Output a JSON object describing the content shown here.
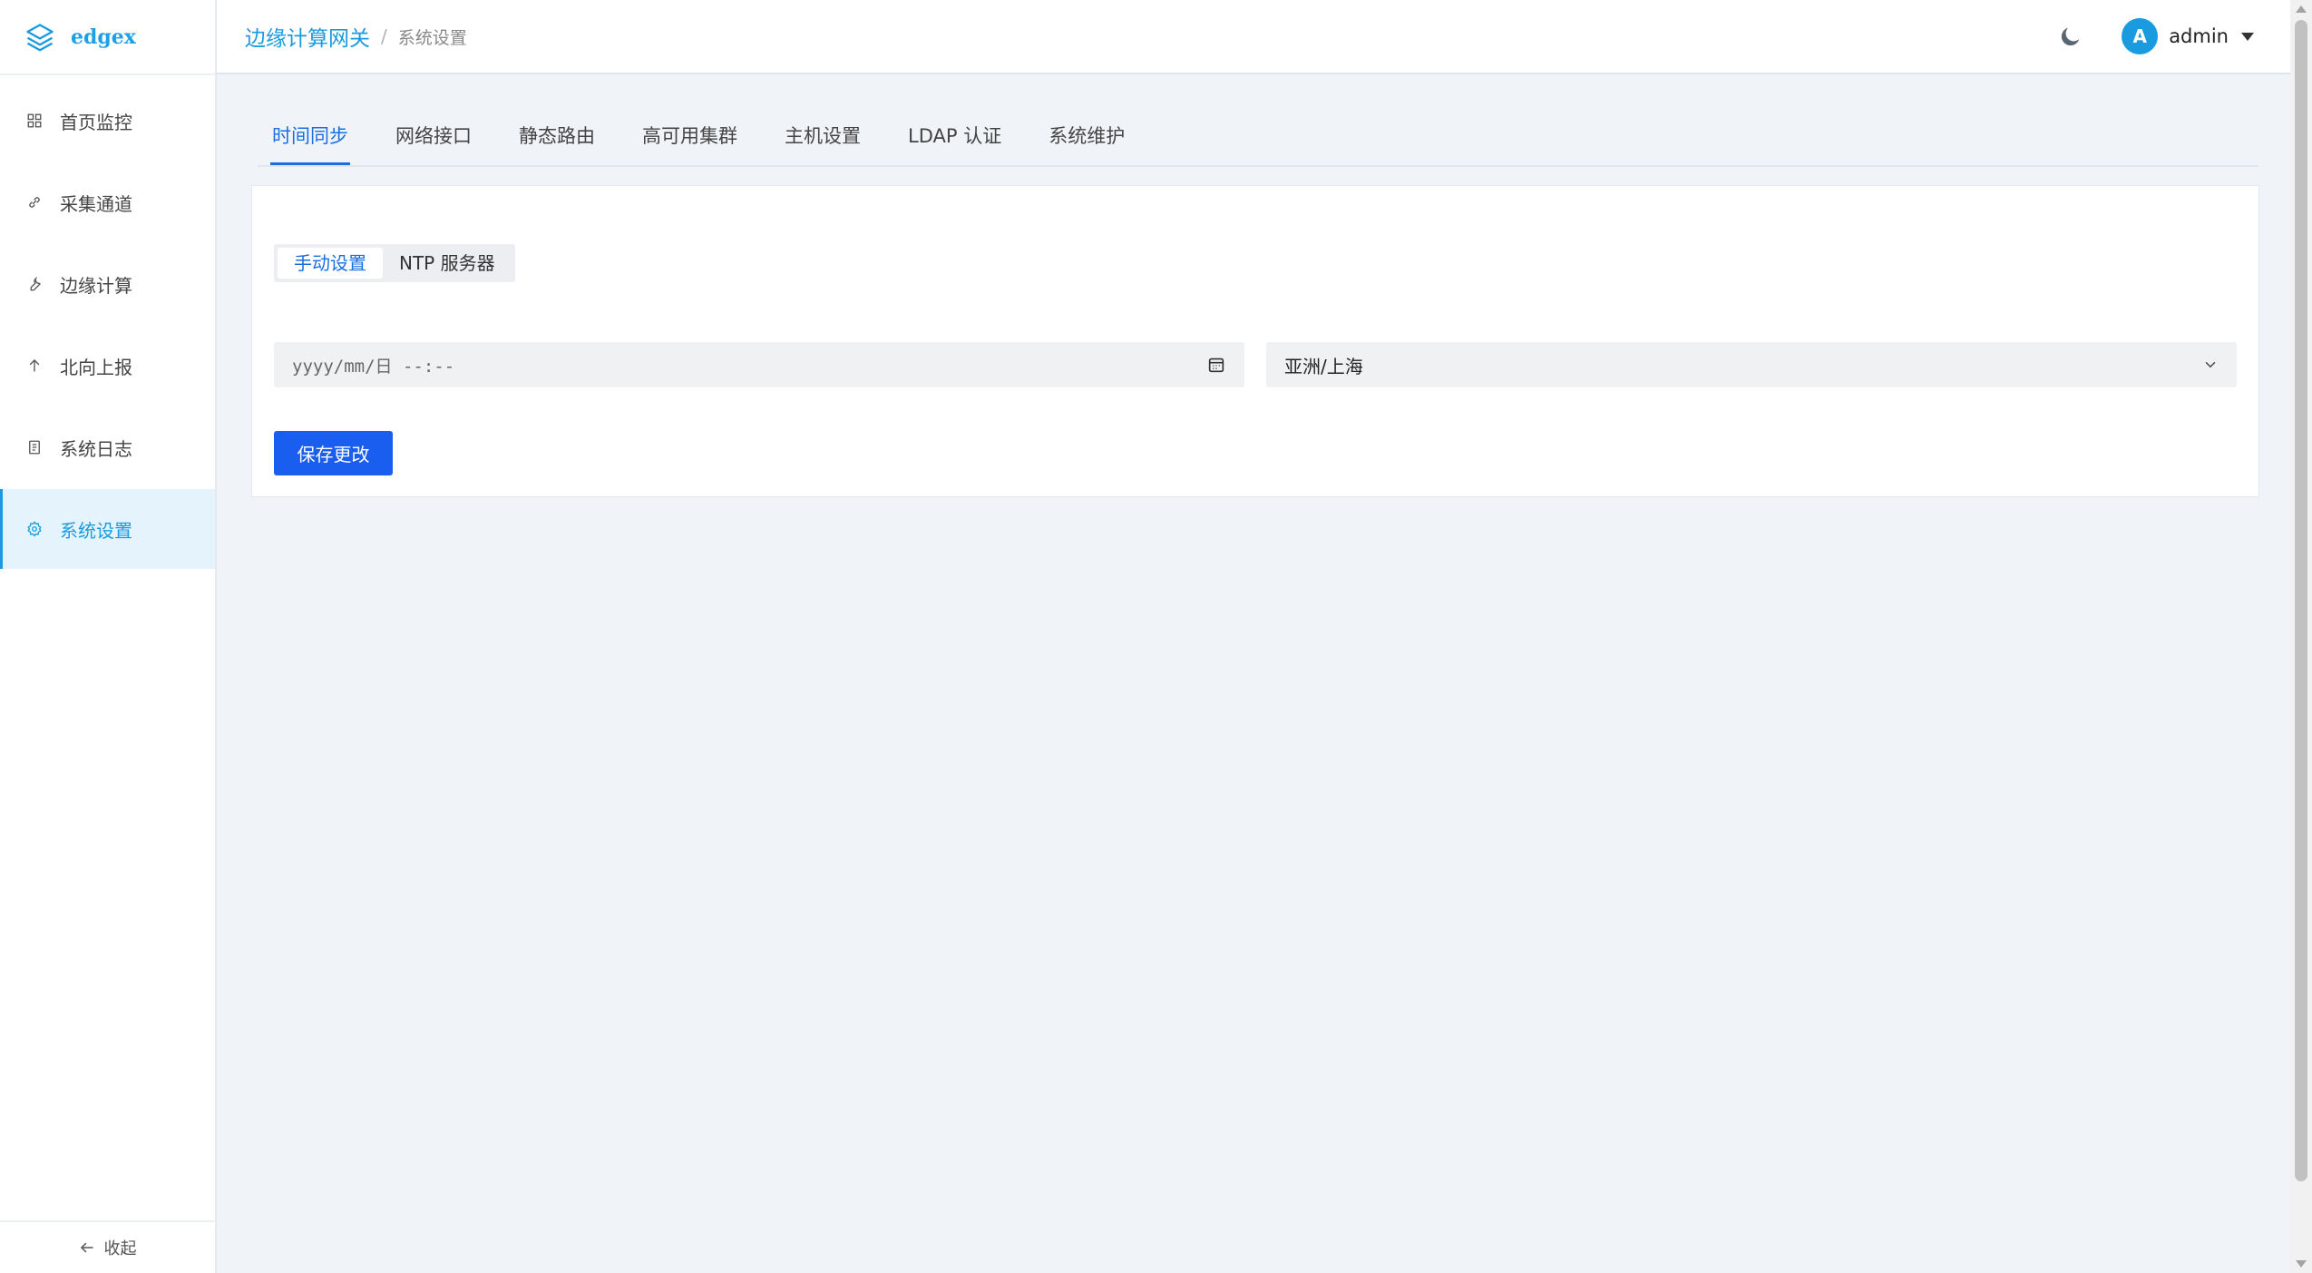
{
  "app": {
    "logo_text": "edgex"
  },
  "sidebar": {
    "items": [
      {
        "label": "首页监控",
        "icon": "grid-icon"
      },
      {
        "label": "采集通道",
        "icon": "link-icon"
      },
      {
        "label": "边缘计算",
        "icon": "wrench-icon"
      },
      {
        "label": "北向上报",
        "icon": "arrow-up-icon"
      },
      {
        "label": "系统日志",
        "icon": "document-icon"
      },
      {
        "label": "系统设置",
        "icon": "gear-icon",
        "active": true
      }
    ],
    "collapse_label": "收起"
  },
  "header": {
    "breadcrumb_main": "边缘计算网关",
    "breadcrumb_sep": "/",
    "breadcrumb_sub": "系统设置",
    "avatar_letter": "A",
    "username": "admin"
  },
  "tabs": [
    {
      "label": "时间同步",
      "active": true
    },
    {
      "label": "网络接口"
    },
    {
      "label": "静态路由"
    },
    {
      "label": "高可用集群"
    },
    {
      "label": "主机设置"
    },
    {
      "label": "LDAP 认证"
    },
    {
      "label": "系统维护"
    }
  ],
  "time_sync": {
    "mode_options": [
      {
        "label": "手动设置",
        "active": true
      },
      {
        "label": "NTP 服务器"
      }
    ],
    "datetime_placeholder": "yyyy/mm/日 --:--",
    "timezone_value": "亚洲/上海",
    "save_label": "保存更改"
  },
  "colors": {
    "accent": "#1a9be0",
    "tab_active": "#1a6fe0",
    "button": "#1a5ef0",
    "background": "#f0f3f8"
  }
}
